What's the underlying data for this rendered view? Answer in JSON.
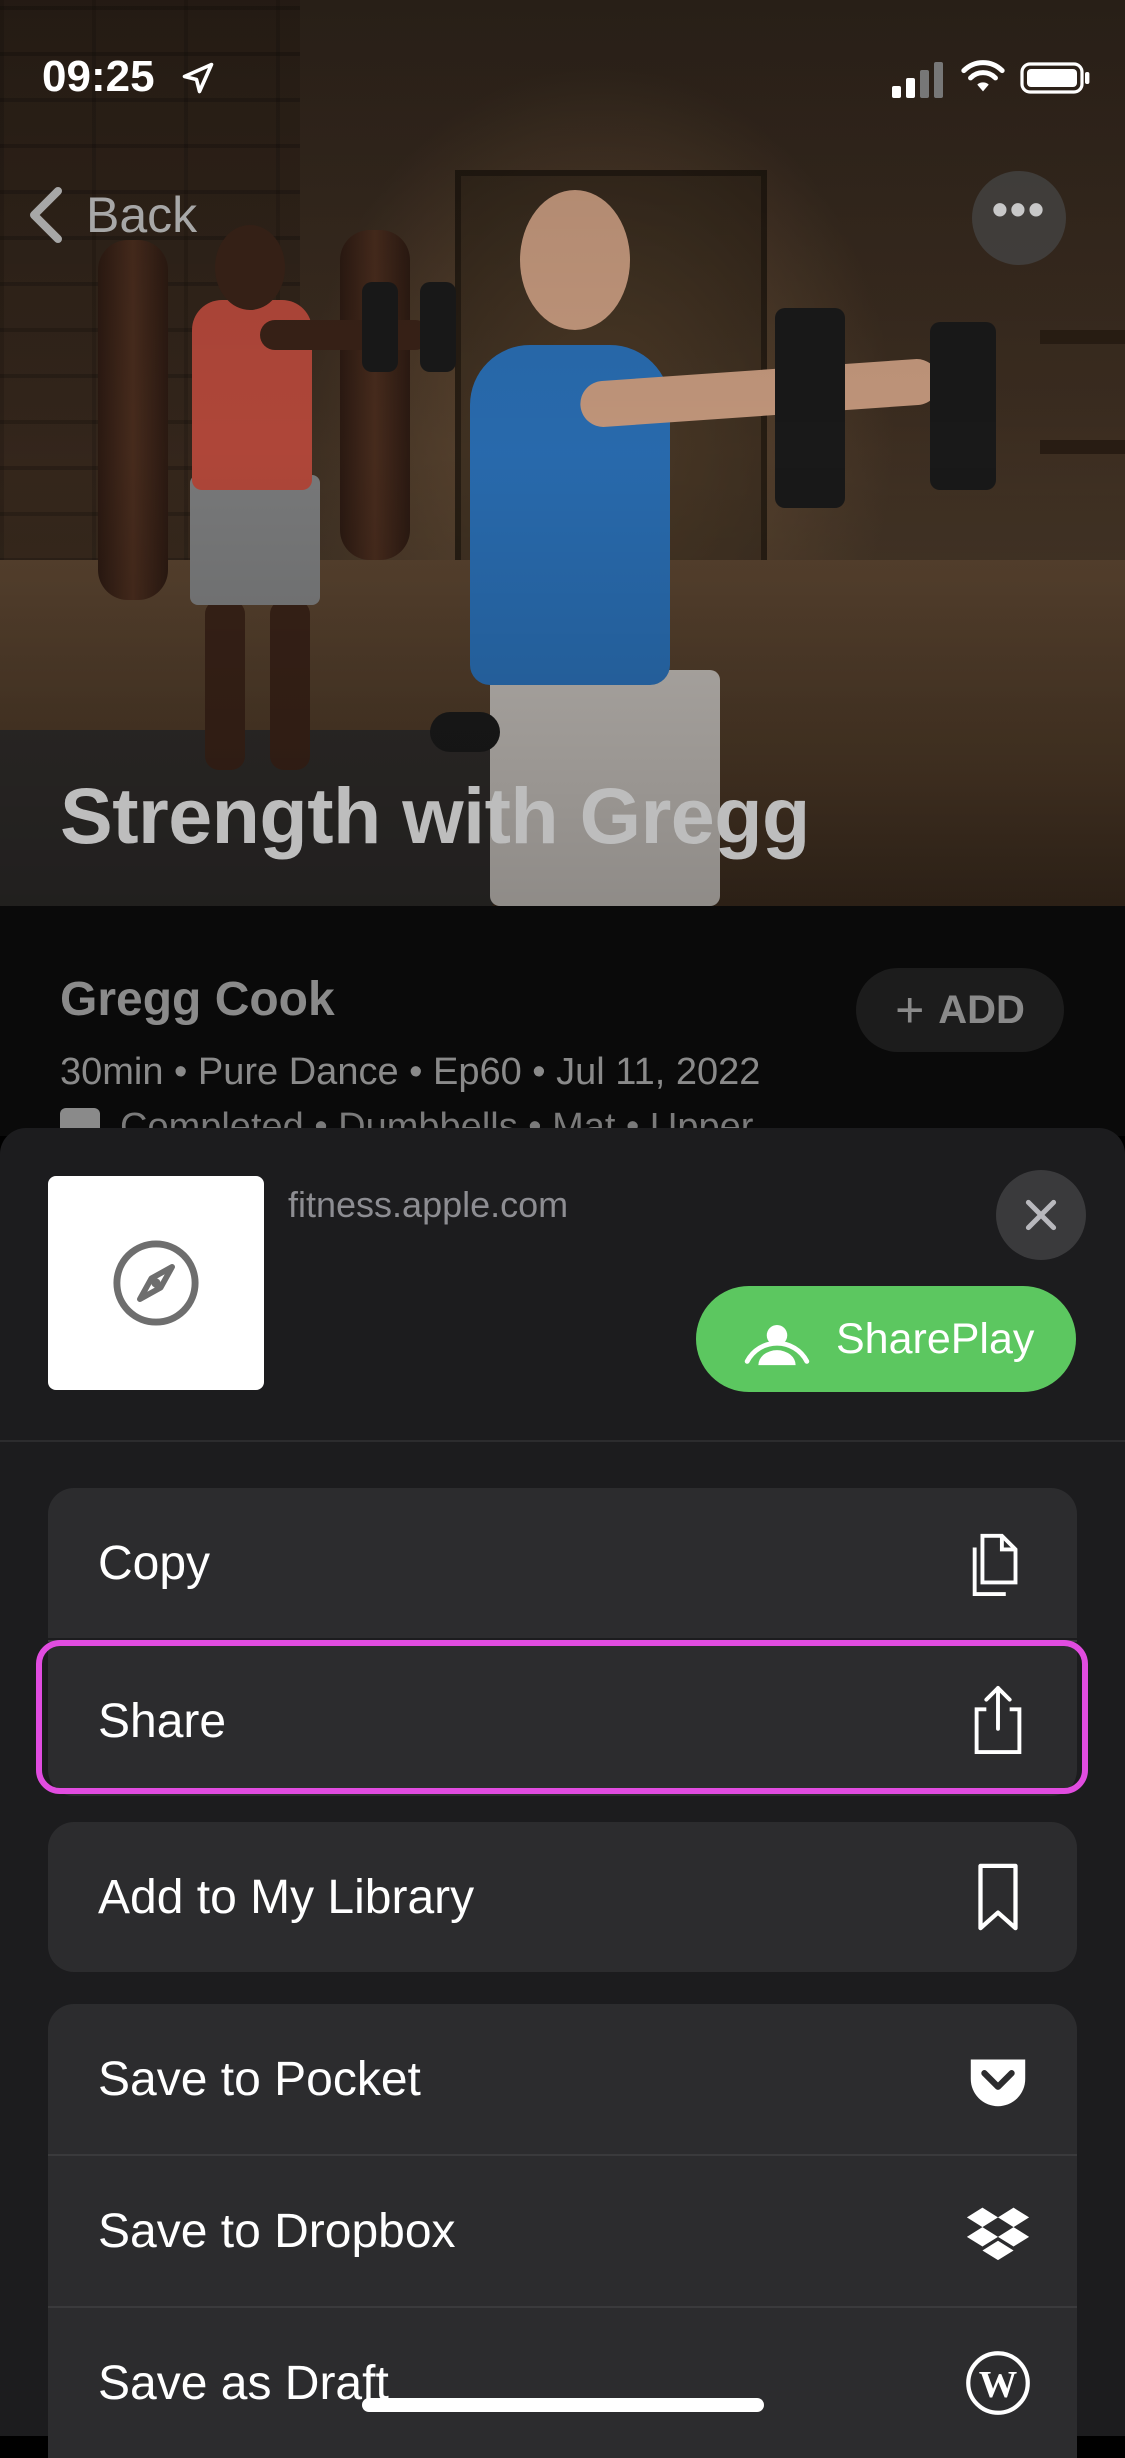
{
  "status_bar": {
    "time": "09:25"
  },
  "nav": {
    "back_label": "Back"
  },
  "workout": {
    "title": "Strength with Gregg",
    "trainer": "Gregg Cook",
    "meta_line1": "30min • Pure Dance • Ep60 • Jul 11, 2022",
    "meta_line2": "Completed • Dumbbells • Mat • Upper",
    "add_label": "ADD"
  },
  "share_sheet": {
    "domain": "fitness.apple.com",
    "shareplay_label": "SharePlay",
    "actions": [
      {
        "label": "Copy",
        "icon": "copy-icon"
      },
      {
        "label": "Share",
        "icon": "share-icon"
      },
      {
        "label": "Add to My Library",
        "icon": "bookmark-icon"
      },
      {
        "label": "Save to Pocket",
        "icon": "pocket-icon"
      },
      {
        "label": "Save to Dropbox",
        "icon": "dropbox-icon"
      },
      {
        "label": "Save as Draft",
        "icon": "wordpress-icon"
      }
    ]
  },
  "colors": {
    "highlight": "#e14ce0",
    "shareplay_green": "#5cc760",
    "sheet_bg": "#1c1c1e",
    "row_bg": "#2c2c2e"
  }
}
